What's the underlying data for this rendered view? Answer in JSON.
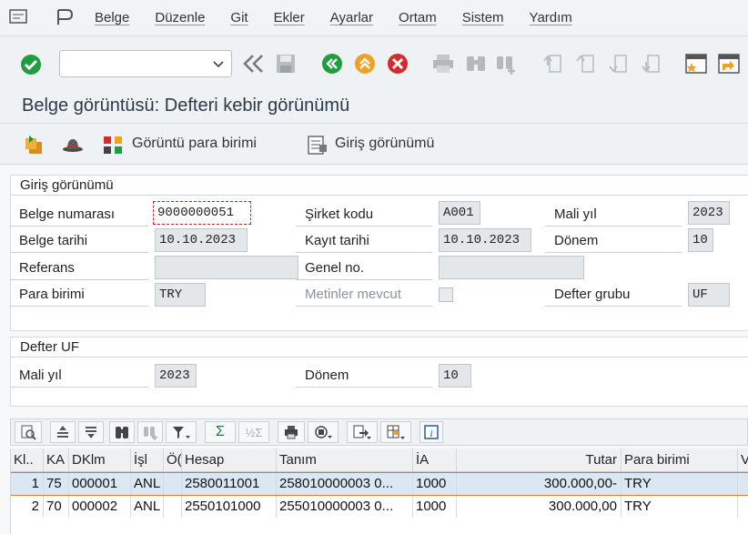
{
  "menu": [
    "Belge",
    "Düzenle",
    "Git",
    "Ekler",
    "Ayarlar",
    "Ortam",
    "Sistem",
    "Yardım"
  ],
  "title": "Belge görüntüsü: Defteri kebir görünümü",
  "app_toolbar": {
    "currency_label": "Görüntü para birimi",
    "entry_view_label": "Giriş görünümü"
  },
  "entry_group": {
    "title": "Giriş görünümü",
    "doc_number_label": "Belge numarası",
    "doc_number": "9000000051",
    "company_code_label": "Şirket kodu",
    "company_code": "A001",
    "fiscal_year_label": "Mali yıl",
    "fiscal_year": "2023",
    "doc_date_label": "Belge tarihi",
    "doc_date": "10.10.2023",
    "posting_date_label": "Kayıt tarihi",
    "posting_date": "10.10.2023",
    "period_label": "Dönem",
    "period": "10",
    "reference_label": "Referans",
    "reference": "",
    "general_no_label": "Genel no.",
    "general_no": "",
    "currency_label": "Para birimi",
    "currency": "TRY",
    "texts_label": "Metinler mevcut",
    "ledger_group_label": "Defter grubu",
    "ledger_group": "UF"
  },
  "ledger_group_box": {
    "title": "Defter UF",
    "fiscal_year_label": "Mali yıl",
    "fiscal_year": "2023",
    "period_label": "Dönem",
    "period": "10"
  },
  "grid": {
    "headers": [
      "Kl..",
      "KA",
      "DKlm",
      "İşl",
      "Ö(",
      "Hesap",
      "Tanım",
      "İA",
      "Tutar",
      "Para birimi",
      "V"
    ],
    "rows": [
      [
        "1",
        "75",
        "000001",
        "ANL",
        "",
        "2580011001",
        "258010000003 0...",
        "1000",
        "300.000,00-",
        "TRY"
      ],
      [
        "2",
        "70",
        "000002",
        "ANL",
        "",
        "2550101000",
        "255010000003 0...",
        "1000",
        "300.000,00",
        "TRY"
      ]
    ]
  },
  "colors": {
    "green": "#1f9d3f",
    "orange": "#f0a024",
    "red": "#d42b2b",
    "focus": "#c1272d"
  }
}
